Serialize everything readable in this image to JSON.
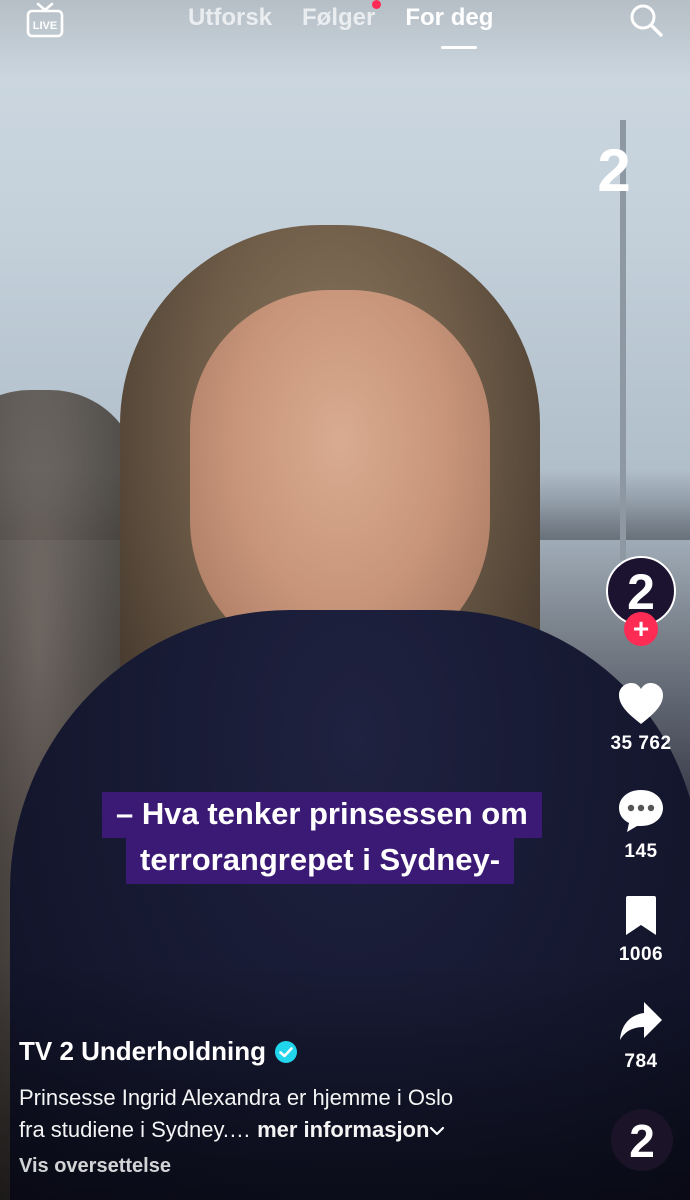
{
  "top_nav": {
    "live_label": "LIVE",
    "tabs": [
      {
        "label": "Utforsk"
      },
      {
        "label": "Følger"
      },
      {
        "label": "For deg"
      }
    ]
  },
  "video": {
    "watermark": "2",
    "caption_line_1": "– Hva tenker prinsessen om",
    "caption_line_2": "terrorangrepet i Sydney-"
  },
  "rail": {
    "avatar_logo": "2",
    "likes": "35 762",
    "comments": "145",
    "saves": "1006",
    "shares": "784",
    "disc_logo": "2"
  },
  "post": {
    "author": "TV 2 Underholdning",
    "description_line_1": "Prinsesse Ingrid Alexandra er hjemme i Oslo",
    "description_line_2": "fra studiene i Sydney.…",
    "more_label": "mer informasjon",
    "translate_label": "Vis oversettelse"
  },
  "colors": {
    "accent_red": "#fe2c55",
    "caption_purple": "#3b1a76",
    "verified_blue": "#20d5ec"
  },
  "icons": [
    "live-icon",
    "search-icon",
    "heart-icon",
    "comment-icon",
    "bookmark-icon",
    "share-icon",
    "verified-icon",
    "chevron-down-icon"
  ]
}
